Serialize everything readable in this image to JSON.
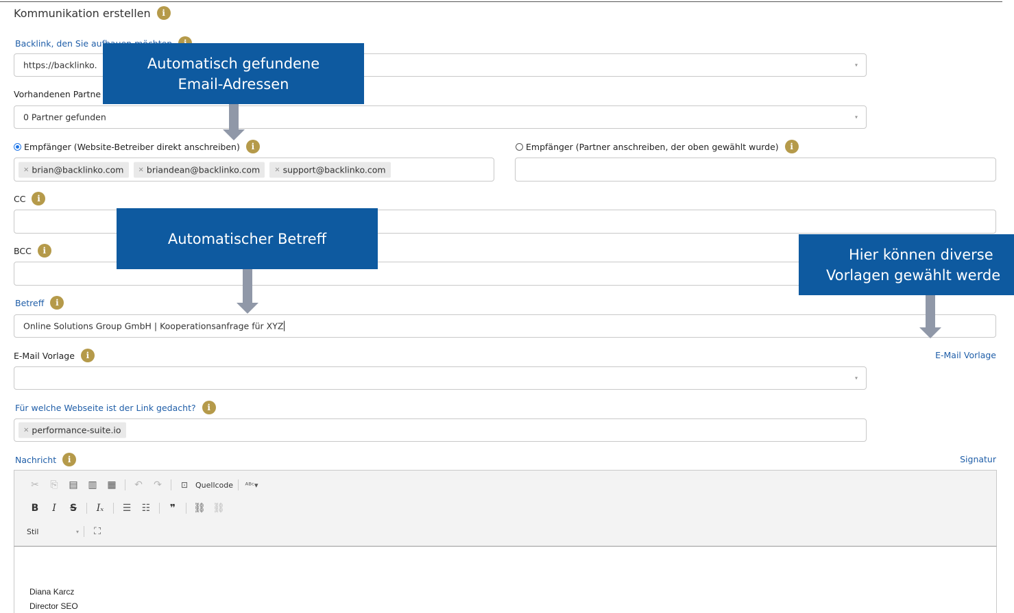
{
  "title": "Kommunikation erstellen",
  "backlink": {
    "label": "Backlink, den Sie aufbauen möchten",
    "value": "https://backlinko."
  },
  "partner": {
    "label": "Vorhandenen Partne",
    "value": "0 Partner gefunden"
  },
  "recipient_direct": {
    "label": "Empfänger (Website-Betreiber direkt anschreiben)",
    "selected": true,
    "emails": [
      "brian@backlinko.com",
      "briandean@backlinko.com",
      "support@backlinko.com"
    ]
  },
  "recipient_partner": {
    "label": "Empfänger (Partner anschreiben, der oben gewählt wurde)",
    "selected": false
  },
  "cc": {
    "label": "CC"
  },
  "bcc": {
    "label": "BCC"
  },
  "subject": {
    "label": "Betreff",
    "value": "Online Solutions Group GmbH | Kooperationsanfrage für XYZ"
  },
  "template": {
    "label": "E-Mail Vorlage",
    "link": "E-Mail Vorlage",
    "value": ""
  },
  "website": {
    "label": "Für welche Webseite ist der Link gedacht?",
    "tag": "performance-suite.io"
  },
  "message": {
    "label": "Nachricht",
    "signature_link": "Signatur",
    "toolbar": {
      "source": "Quellcode",
      "style": "Stil"
    },
    "body_lines": [
      "Diana Karcz",
      "Director SEO"
    ]
  },
  "info_glyph": "i",
  "tag_remove": "×",
  "caret": "▾",
  "callouts": {
    "emails": [
      "Automatisch gefundene",
      "Email-Adressen"
    ],
    "subject": [
      "Automatischer Betreff"
    ],
    "templates": [
      "Hier können diverse",
      "Vorlagen gewählt werde"
    ]
  },
  "colors": {
    "accent_blue": "#1f5ea8",
    "callout_bg": "#0e5aa0",
    "info_badge": "#b59a4a",
    "arrow": "#9098a8"
  }
}
